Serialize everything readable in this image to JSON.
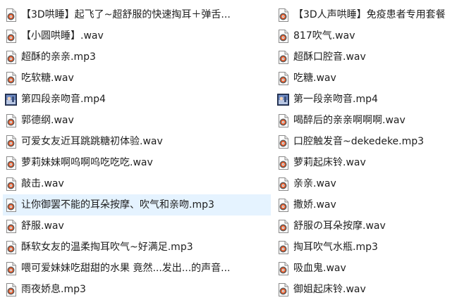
{
  "colors": {
    "selection_background": "#e5f3ff",
    "text": "#1e1e1e",
    "background": "#ffffff"
  },
  "files": {
    "left": [
      {
        "name": "【3D哄睡】起飞了~超舒服的快速掏耳＋弹舌...",
        "icon": "audio-file-icon",
        "selected": false
      },
      {
        "name": "【小圆哄睡】.wav",
        "icon": "audio-file-icon",
        "selected": false
      },
      {
        "name": "超酥的亲亲.mp3",
        "icon": "audio-file-icon",
        "selected": false
      },
      {
        "name": "吃软糖.wav",
        "icon": "audio-file-icon",
        "selected": false
      },
      {
        "name": "第四段亲吻音.mp4",
        "icon": "video-file-icon",
        "selected": false
      },
      {
        "name": "郭德纲.wav",
        "icon": "audio-file-icon",
        "selected": false
      },
      {
        "name": "可爱女友近耳跳跳糖初体验.wav",
        "icon": "audio-file-icon",
        "selected": false
      },
      {
        "name": "萝莉妹妹啊呜啊呜吃吃吃.wav",
        "icon": "audio-file-icon",
        "selected": false
      },
      {
        "name": "敲击.wav",
        "icon": "audio-file-icon",
        "selected": false
      },
      {
        "name": "让你御罢不能的耳朵按摩、吹气和亲吻.mp3",
        "icon": "audio-file-icon",
        "selected": true
      },
      {
        "name": "舒服.wav",
        "icon": "audio-file-icon",
        "selected": false
      },
      {
        "name": "酥软女友的温柔掏耳吹气~好满足.mp3",
        "icon": "audio-file-icon",
        "selected": false
      },
      {
        "name": "喂可爱妹妹吃甜甜的水果 竟然...发出...的声音...",
        "icon": "audio-file-icon",
        "selected": false
      },
      {
        "name": "雨夜娇息.mp3",
        "icon": "audio-file-icon",
        "selected": false
      }
    ],
    "right": [
      {
        "name": "【3D人声哄睡】免疫患者专用套餐",
        "icon": "audio-file-icon",
        "selected": false
      },
      {
        "name": "817吹气.wav",
        "icon": "audio-file-icon",
        "selected": false
      },
      {
        "name": "超酥口腔音.wav",
        "icon": "audio-file-icon",
        "selected": false
      },
      {
        "name": "吃糖.wav",
        "icon": "audio-file-icon",
        "selected": false
      },
      {
        "name": "第一段亲吻音.mp4",
        "icon": "video-file-icon",
        "selected": false
      },
      {
        "name": "喝醉后的亲亲啊啊啊.wav",
        "icon": "audio-file-icon",
        "selected": false
      },
      {
        "name": "口腔触发音~dekedeke.mp3",
        "icon": "audio-file-icon",
        "selected": false
      },
      {
        "name": "萝莉起床铃.wav",
        "icon": "audio-file-icon",
        "selected": false
      },
      {
        "name": "亲亲.wav",
        "icon": "audio-file-icon",
        "selected": false
      },
      {
        "name": "撒娇.wav",
        "icon": "audio-file-icon",
        "selected": false
      },
      {
        "name": "舒服の耳朵按摩.wav",
        "icon": "audio-file-icon",
        "selected": false
      },
      {
        "name": "掏耳吹气水瓶.mp3",
        "icon": "audio-file-icon",
        "selected": false
      },
      {
        "name": "吸血鬼.wav",
        "icon": "audio-file-icon",
        "selected": false
      },
      {
        "name": "御姐起床铃.wav",
        "icon": "audio-file-icon",
        "selected": false
      }
    ]
  }
}
